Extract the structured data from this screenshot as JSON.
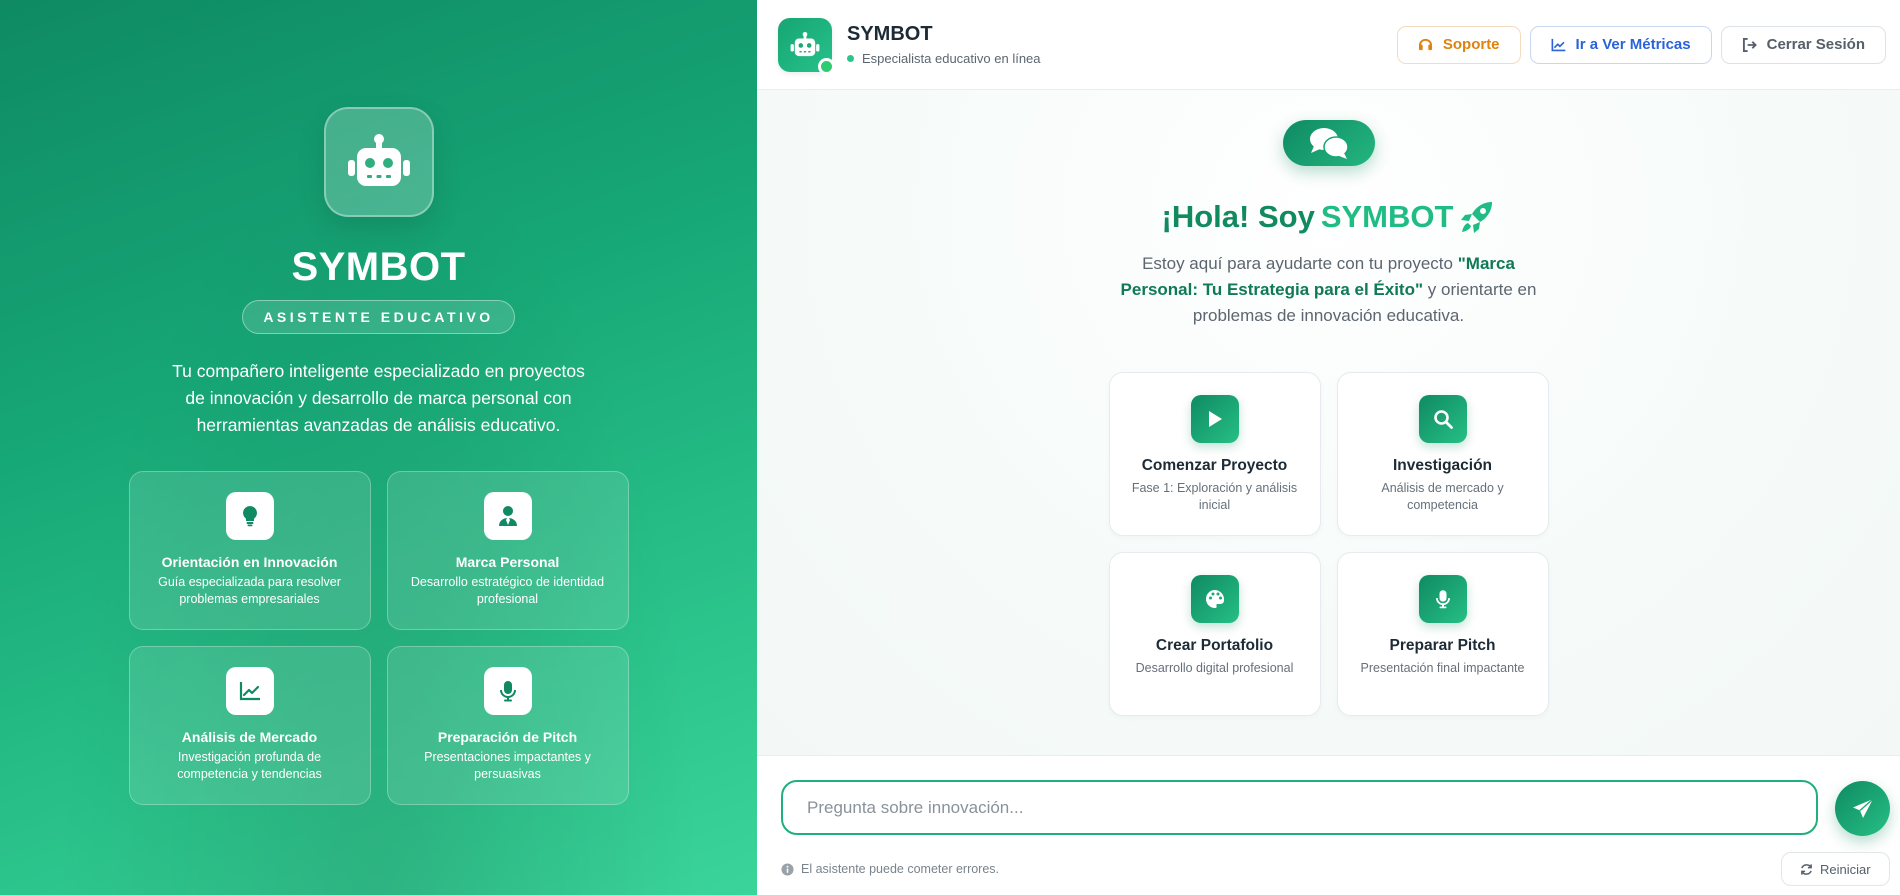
{
  "sidebar": {
    "title": "SYMBOT",
    "subtitle": "ASISTENTE EDUCATIVO",
    "description": "Tu compañero inteligente especializado en proyectos de innovación y desarrollo de marca personal con herramientas avanzadas de análisis educativo.",
    "features": [
      {
        "icon": "lightbulb-icon",
        "title": "Orientación en Innovación",
        "desc": "Guía especializada para resolver problemas empresariales"
      },
      {
        "icon": "user-tie-icon",
        "title": "Marca Personal",
        "desc": "Desarrollo estratégico de identidad profesional"
      },
      {
        "icon": "chart-line-icon",
        "title": "Análisis de Mercado",
        "desc": "Investigación profunda de competencia y tendencias"
      },
      {
        "icon": "microphone-icon",
        "title": "Preparación de Pitch",
        "desc": "Presentaciones impactantes y persuasivas"
      }
    ]
  },
  "header": {
    "title": "SYMBOT",
    "status": "Especialista educativo en línea",
    "support_label": "Soporte",
    "metrics_label": "Ir a Ver Métricas",
    "logout_label": "Cerrar Sesión"
  },
  "welcome": {
    "greeting_prefix": "¡Hola! Soy",
    "greeting_name": "SYMBOT",
    "intro_before": "Estoy aquí para ayudarte con tu proyecto",
    "intro_project": "\"Marca Personal: Tu Estrategia para el Éxito\"",
    "intro_after": "y orientarte en problemas de innovación educativa."
  },
  "quick_actions": [
    {
      "icon": "play-icon",
      "title": "Comenzar Proyecto",
      "desc": "Fase 1: Exploración y análisis inicial"
    },
    {
      "icon": "search-icon",
      "title": "Investigación",
      "desc": "Análisis de mercado y competencia"
    },
    {
      "icon": "palette-icon",
      "title": "Crear Portafolio",
      "desc": "Desarrollo digital profesional"
    },
    {
      "icon": "microphone-icon",
      "title": "Preparar Pitch",
      "desc": "Presentación final impactante"
    }
  ],
  "composer": {
    "placeholder": "Pregunta sobre innovación...",
    "disclaimer": "El asistente puede cometer errores.",
    "reset_label": "Reiniciar"
  },
  "colors": {
    "brand": "#16a673",
    "brand_light": "#2bc48b",
    "support": "#e0820e",
    "metrics": "#2b63d9"
  }
}
